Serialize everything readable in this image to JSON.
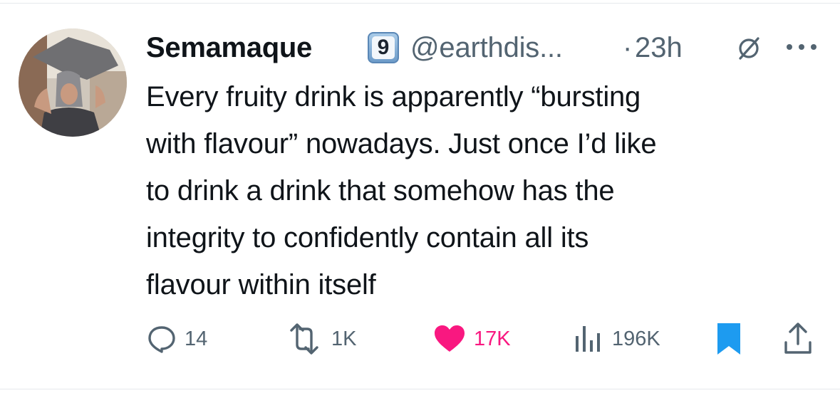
{
  "user": {
    "display_name": "Semamaque",
    "badge_number": "9",
    "handle": "@earthdis...",
    "separator": "·",
    "time": "23h"
  },
  "tweet": {
    "text": "Every fruity drink is apparently “bursting\nwith flavour” nowadays. Just once I’d like\nto drink a drink that somehow has the\nintegrity to confidently contain all its\nflavour within itself"
  },
  "actions": {
    "replies": "14",
    "reposts": "1K",
    "likes": "17K",
    "views": "196K"
  },
  "icons": {
    "reply": "reply-icon",
    "repost": "repost-icon",
    "like": "heart-icon",
    "views": "views-icon",
    "bookmark": "bookmark-icon",
    "share": "share-icon",
    "grok": "grok-icon",
    "more": "more-icon"
  },
  "colors": {
    "text": "#0f1419",
    "secondary": "#536471",
    "like": "#f91880",
    "bookmark": "#1d9bf0"
  }
}
